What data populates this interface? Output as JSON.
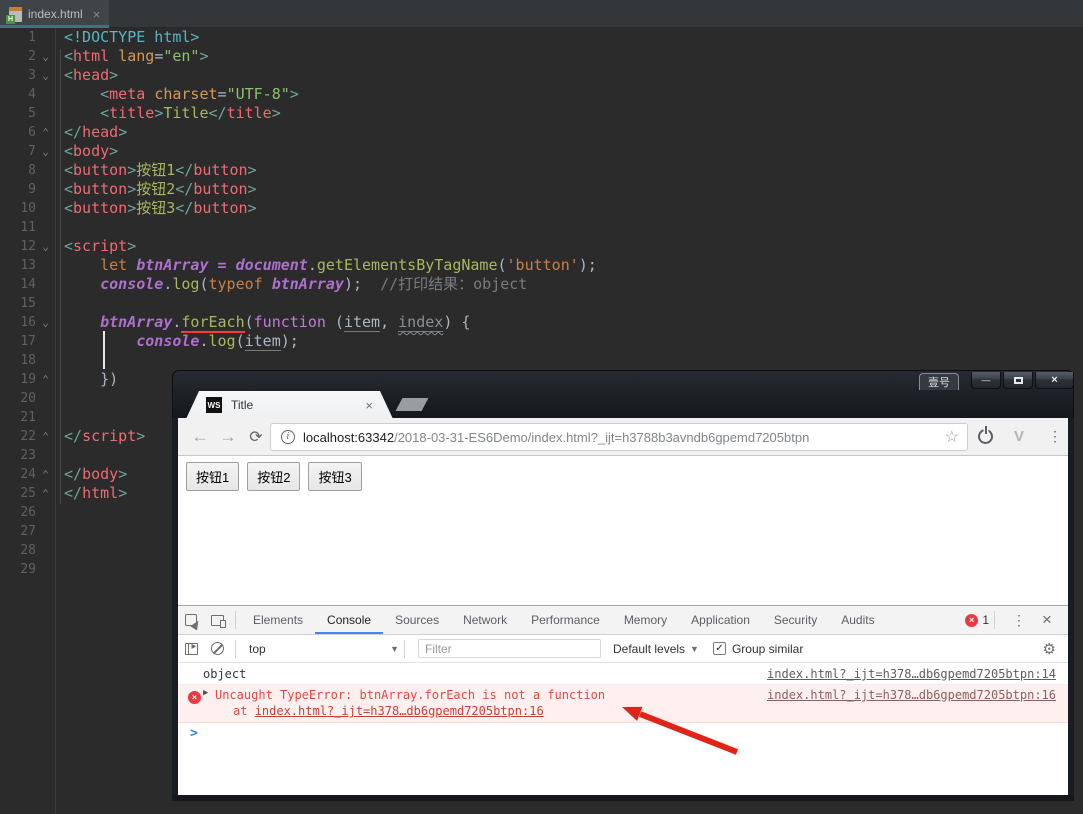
{
  "colors": {
    "editor_bg": "#2b2b2b",
    "tab_underline_teal": "#3a747c",
    "devtools_accent_blue": "#4285f4",
    "error_red": "#e04a42",
    "error_bg": "#fff0f0",
    "arrow_red": "#e02419",
    "error_badge_red": "#eb3941"
  },
  "icons": {
    "fold_down": "⌄",
    "fold_up": "⌃",
    "close": "×",
    "min": "—",
    "back": "←",
    "forward": "→",
    "reload": "⟳",
    "star": "☆",
    "menu_dots": "⋮",
    "gear": "⚙",
    "caret_down": "▼",
    "check": "✓",
    "expand_triangle": "▶",
    "prompt": ">",
    "error_x": "×",
    "info": "i"
  },
  "ide": {
    "tab_label": "index.html",
    "lines": [
      {
        "n": 1,
        "seg": [
          [
            "doctype",
            "<!DOCTYPE html>"
          ]
        ]
      },
      {
        "n": 2,
        "fold": "d",
        "seg": [
          [
            "br",
            "<"
          ],
          [
            "tag",
            "html"
          ],
          [
            "plain",
            " "
          ],
          [
            "attr",
            "lang"
          ],
          [
            "plain",
            "="
          ],
          [
            "str",
            "\"en\""
          ],
          [
            "br",
            ">"
          ]
        ]
      },
      {
        "n": 3,
        "fold": "d",
        "seg": [
          [
            "br",
            "<"
          ],
          [
            "tag",
            "head"
          ],
          [
            "br",
            ">"
          ]
        ]
      },
      {
        "n": 4,
        "seg": [
          [
            "plain",
            "    "
          ],
          [
            "br",
            "<"
          ],
          [
            "tag",
            "meta"
          ],
          [
            "plain",
            " "
          ],
          [
            "attr",
            "charset"
          ],
          [
            "plain",
            "="
          ],
          [
            "str",
            "\"UTF-8\""
          ],
          [
            "br",
            ">"
          ]
        ]
      },
      {
        "n": 5,
        "seg": [
          [
            "plain",
            "    "
          ],
          [
            "br",
            "<"
          ],
          [
            "tag",
            "title"
          ],
          [
            "br",
            ">"
          ],
          [
            "text",
            "Title"
          ],
          [
            "br",
            "</"
          ],
          [
            "tag",
            "title"
          ],
          [
            "br",
            ">"
          ]
        ]
      },
      {
        "n": 6,
        "fold": "u",
        "seg": [
          [
            "br",
            "</"
          ],
          [
            "tag",
            "head"
          ],
          [
            "br",
            ">"
          ]
        ]
      },
      {
        "n": 7,
        "fold": "d",
        "seg": [
          [
            "br",
            "<"
          ],
          [
            "tag",
            "body"
          ],
          [
            "br",
            ">"
          ]
        ]
      },
      {
        "n": 8,
        "seg": [
          [
            "br",
            "<"
          ],
          [
            "tag",
            "button"
          ],
          [
            "br",
            ">"
          ],
          [
            "text",
            "按钮1"
          ],
          [
            "br",
            "</"
          ],
          [
            "tag",
            "button"
          ],
          [
            "br",
            ">"
          ]
        ]
      },
      {
        "n": 9,
        "seg": [
          [
            "br",
            "<"
          ],
          [
            "tag",
            "button"
          ],
          [
            "br",
            ">"
          ],
          [
            "text",
            "按钮2"
          ],
          [
            "br",
            "</"
          ],
          [
            "tag",
            "button"
          ],
          [
            "br",
            ">"
          ]
        ]
      },
      {
        "n": 10,
        "seg": [
          [
            "br",
            "<"
          ],
          [
            "tag",
            "button"
          ],
          [
            "br",
            ">"
          ],
          [
            "text",
            "按钮3"
          ],
          [
            "br",
            "</"
          ],
          [
            "tag",
            "button"
          ],
          [
            "br",
            ">"
          ]
        ]
      },
      {
        "n": 11,
        "seg": []
      },
      {
        "n": 12,
        "fold": "d",
        "seg": [
          [
            "br",
            "<"
          ],
          [
            "tag",
            "script"
          ],
          [
            "br",
            ">"
          ]
        ]
      },
      {
        "n": 13,
        "seg": [
          [
            "plain",
            "    "
          ],
          [
            "kw",
            "let "
          ],
          [
            "var",
            "btnArray"
          ],
          [
            "op",
            " = "
          ],
          [
            "var",
            "document"
          ],
          [
            "plain",
            "."
          ],
          [
            "meth",
            "getElementsByTagName"
          ],
          [
            "plain",
            "("
          ],
          [
            "strjs",
            "'button'"
          ],
          [
            "plain",
            ");"
          ]
        ]
      },
      {
        "n": 14,
        "seg": [
          [
            "plain",
            "    "
          ],
          [
            "var",
            "console"
          ],
          [
            "plain",
            "."
          ],
          [
            "meth",
            "log"
          ],
          [
            "plain",
            "("
          ],
          [
            "kw",
            "typeof "
          ],
          [
            "var",
            "btnArray"
          ],
          [
            "plain",
            ");  "
          ],
          [
            "comment",
            "//打印结果：object"
          ]
        ]
      },
      {
        "n": 15,
        "seg": []
      },
      {
        "n": 16,
        "fold": "d",
        "seg": [
          [
            "plain",
            "    "
          ],
          [
            "var",
            "btnArray"
          ],
          [
            "plain",
            "."
          ],
          [
            "metherr",
            "forEach"
          ],
          [
            "plain",
            "("
          ],
          [
            "kwp",
            "function"
          ],
          [
            "plain",
            " ("
          ],
          [
            "param",
            "item"
          ],
          [
            "plain",
            ", "
          ],
          [
            "unused",
            "index"
          ],
          [
            "plain",
            ") {"
          ]
        ]
      },
      {
        "n": 17,
        "seg": [
          [
            "plain",
            "        "
          ],
          [
            "var",
            "console"
          ],
          [
            "plain",
            "."
          ],
          [
            "meth",
            "log"
          ],
          [
            "plain",
            "("
          ],
          [
            "param",
            "item"
          ],
          [
            "plain",
            ");"
          ]
        ]
      },
      {
        "n": 18,
        "seg": []
      },
      {
        "n": 19,
        "fold": "u",
        "seg": [
          [
            "plain",
            "    })"
          ]
        ]
      },
      {
        "n": 20,
        "seg": []
      },
      {
        "n": 21,
        "seg": []
      },
      {
        "n": 22,
        "fold": "u",
        "seg": [
          [
            "br",
            "</"
          ],
          [
            "tag",
            "script"
          ],
          [
            "br",
            ">"
          ]
        ]
      },
      {
        "n": 23,
        "seg": []
      },
      {
        "n": 24,
        "fold": "u",
        "seg": [
          [
            "br",
            "</"
          ],
          [
            "tag",
            "body"
          ],
          [
            "br",
            ">"
          ]
        ]
      },
      {
        "n": 25,
        "fold": "u",
        "seg": [
          [
            "br",
            "</"
          ],
          [
            "tag",
            "html"
          ],
          [
            "br",
            ">"
          ]
        ]
      },
      {
        "n": 26,
        "seg": []
      },
      {
        "n": 27,
        "seg": []
      },
      {
        "n": 28,
        "seg": []
      },
      {
        "n": 29,
        "seg": []
      }
    ]
  },
  "browser": {
    "profile_badge": "壹号",
    "tab": {
      "favicon_text": "WS",
      "title": "Title"
    },
    "url_host": "localhost:63342",
    "url_path": "/2018-03-31-ES6Demo/index.html?_ijt=h3788b3avndb6gpemd7205btpn",
    "page_buttons": [
      "按钮1",
      "按钮2",
      "按钮3"
    ],
    "devtools": {
      "tabs": [
        "Elements",
        "Console",
        "Sources",
        "Network",
        "Performance",
        "Memory",
        "Application",
        "Security",
        "Audits"
      ],
      "active_tab": "Console",
      "error_count": "1",
      "context": "top",
      "filter_placeholder": "Filter",
      "levels_label": "Default levels",
      "group_similar_label": "Group similar",
      "console": {
        "log1_text": "object",
        "log1_link": "index.html?_ijt=h378…db6gpemd7205btpn:14",
        "error_line1": "Uncaught TypeError: btnArray.forEach is not a function",
        "error_at_prefix": "at ",
        "error_stack_link": "index.html?_ijt=h378…db6gpemd7205btpn:16",
        "error_link": "index.html?_ijt=h378…db6gpemd7205btpn:16"
      }
    }
  }
}
